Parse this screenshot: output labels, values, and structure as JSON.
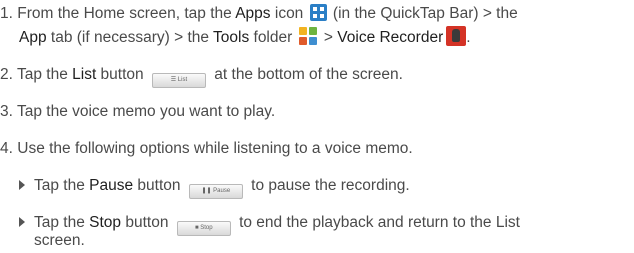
{
  "steps": [
    {
      "num": "1.",
      "line1_a": "From the Home screen, tap the ",
      "apps_label": "Apps",
      "line1_b": " icon ",
      "line1_c": " (in the QuickTap Bar) > the",
      "app_label": "App",
      "line2_a": " tab (if necessary) > the ",
      "tools_label": "Tools",
      "line2_b": " folder ",
      "line2_c": " > ",
      "voice_label": "Voice Recorder",
      "line2_d": "."
    },
    {
      "num": "2.",
      "text_a": "Tap the ",
      "list_label": "List",
      "text_b": " button ",
      "text_c": " at the bottom of the screen."
    },
    {
      "num": "3.",
      "text": "Tap the voice memo you want to play."
    },
    {
      "num": "4.",
      "text": "Use the following options while listening to a voice memo."
    }
  ],
  "sub_steps": [
    {
      "text_a": "Tap the ",
      "label": "Pause",
      "text_b": " button ",
      "text_c": " to pause the recording."
    },
    {
      "text_a": "Tap the ",
      "label": "Stop",
      "text_b": " button ",
      "text_c": " to end the playback and return to the List",
      "text_d": "screen."
    }
  ],
  "button_images": {
    "list": "☰ List",
    "pause": "❚❚ Pause",
    "stop": "■ Stop"
  },
  "colors": {
    "text": "#4a4a4a",
    "apps_icon": "#2b7fc6",
    "recorder_icon": "#d43326"
  },
  "icons": [
    "apps-icon",
    "tools-folder-icon",
    "voice-recorder-icon"
  ]
}
